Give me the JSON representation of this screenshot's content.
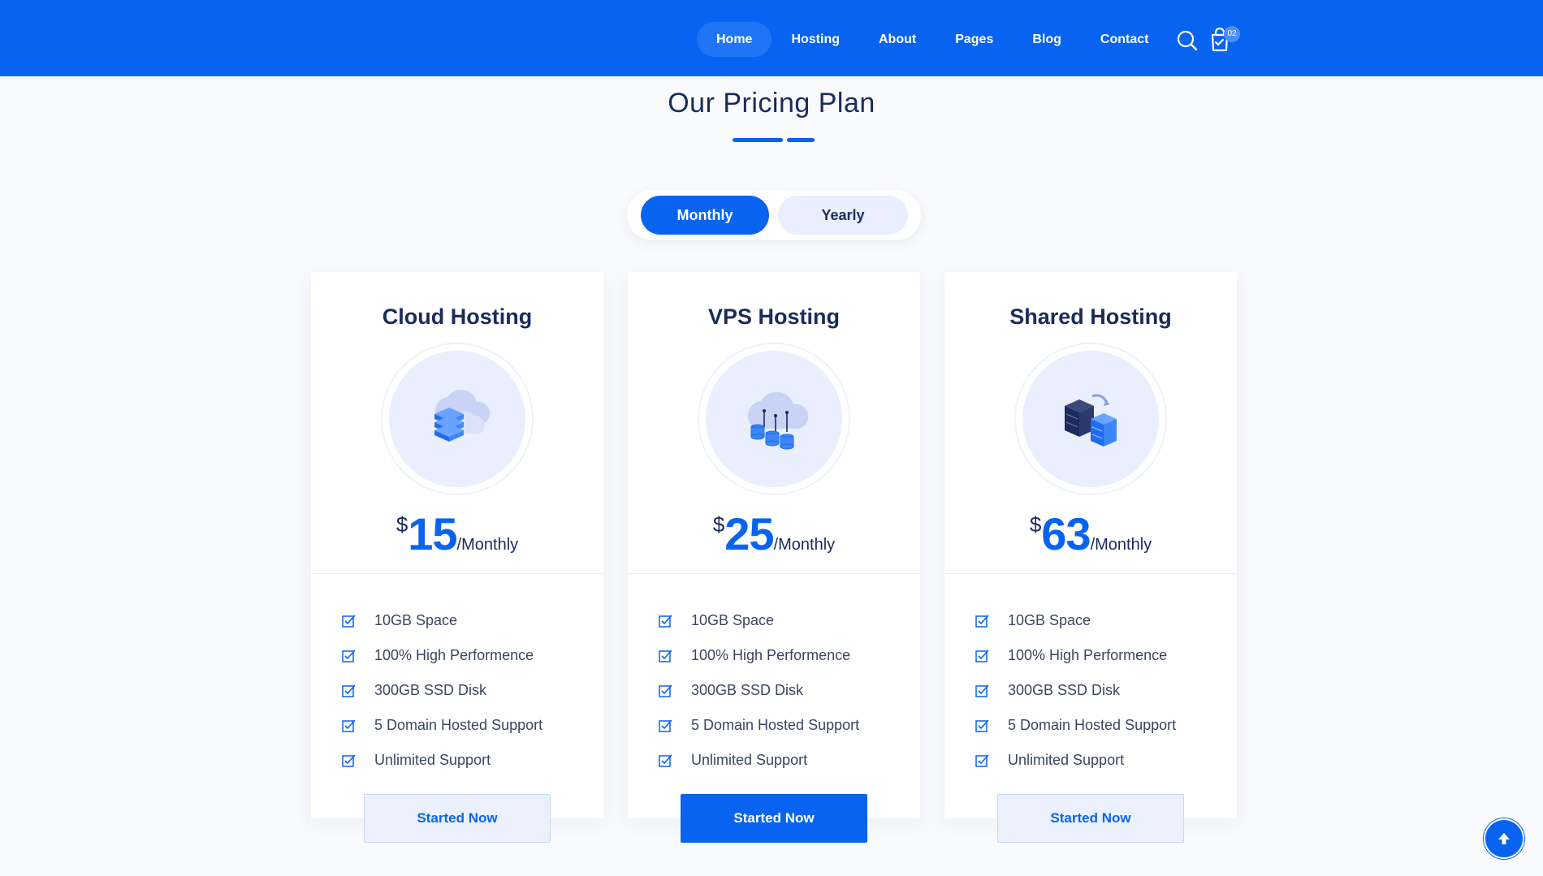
{
  "header": {
    "nav": [
      {
        "label": "Home",
        "active": true
      },
      {
        "label": "Hosting",
        "active": false
      },
      {
        "label": "About",
        "active": false
      },
      {
        "label": "Pages",
        "active": false
      },
      {
        "label": "Blog",
        "active": false
      },
      {
        "label": "Contact",
        "active": false
      }
    ],
    "cart_count": "02",
    "icons": [
      "search-icon",
      "cart-icon"
    ]
  },
  "section": {
    "title": "Our Pricing Plan"
  },
  "billing_toggle": {
    "monthly_label": "Monthly",
    "yearly_label": "Yearly",
    "selected": "Monthly"
  },
  "plans": [
    {
      "title": "Cloud Hosting",
      "icon": "cloud-server-icon",
      "currency": "$",
      "price": "15",
      "period": "/Monthly",
      "features": [
        "10GB Space",
        "100% High Performence",
        "300GB SSD Disk",
        "5 Domain Hosted Support",
        "Unlimited Support"
      ],
      "cta_label": "Started Now",
      "cta_style": "light"
    },
    {
      "title": "VPS Hosting",
      "icon": "cloud-database-icon",
      "currency": "$",
      "price": "25",
      "period": "/Monthly",
      "features": [
        "10GB Space",
        "100% High Performence",
        "300GB SSD Disk",
        "5 Domain Hosted Support",
        "Unlimited Support"
      ],
      "cta_label": "Started Now",
      "cta_style": "dark"
    },
    {
      "title": "Shared Hosting",
      "icon": "shared-servers-icon",
      "currency": "$",
      "price": "63",
      "period": "/Monthly",
      "features": [
        "10GB Space",
        "100% High Performence",
        "300GB SSD Disk",
        "5 Domain Hosted Support",
        "Unlimited Support"
      ],
      "cta_label": "Started Now",
      "cta_style": "light"
    }
  ],
  "colors": {
    "primary": "#0863f0",
    "heading": "#1a2b5c",
    "icon_bg": "#e9effc"
  }
}
